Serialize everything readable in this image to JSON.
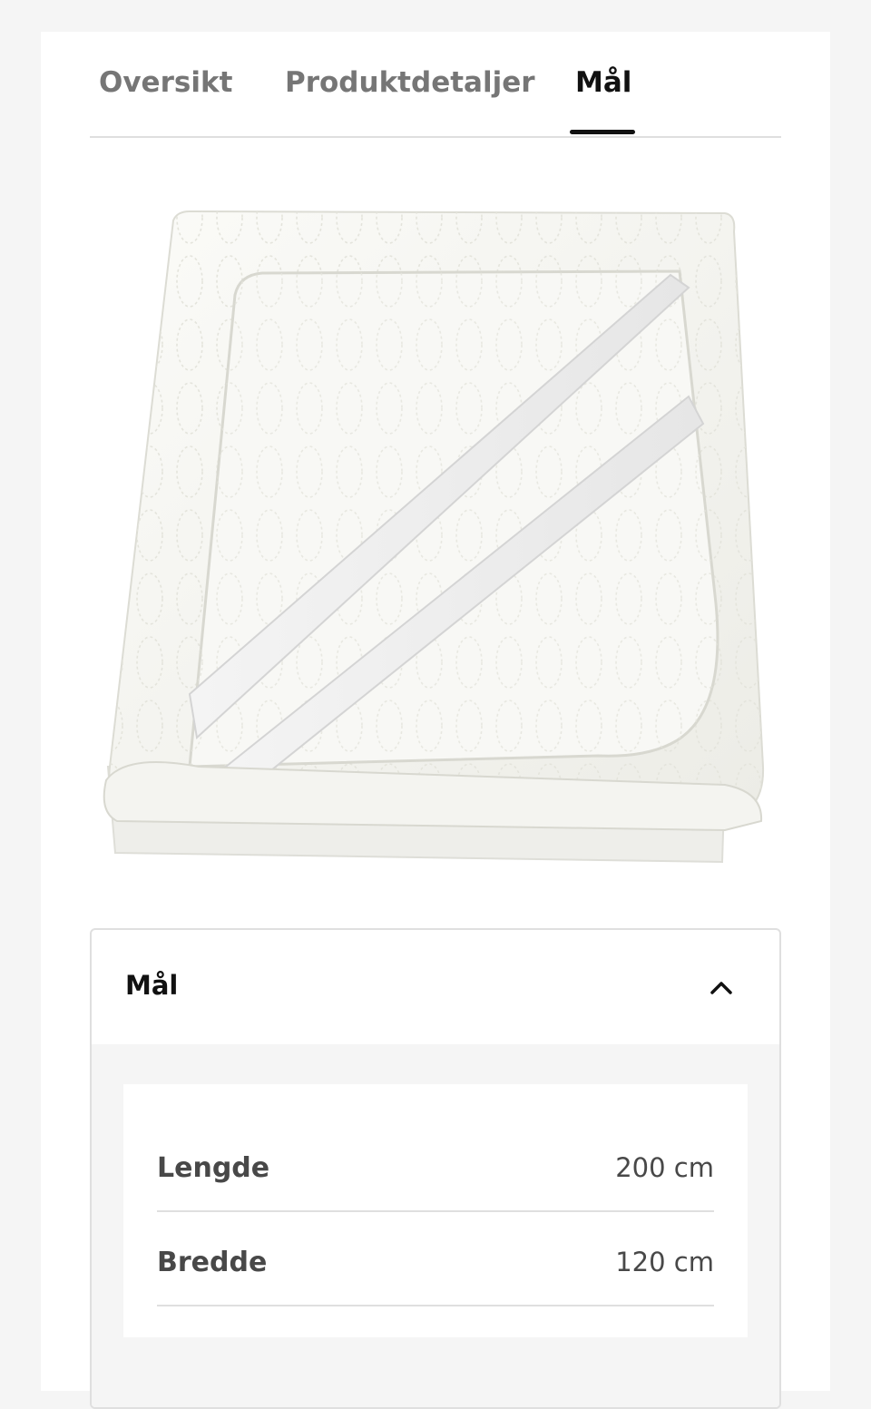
{
  "tabs": [
    {
      "label": "Oversikt",
      "active": false
    },
    {
      "label": "Produktdetaljer",
      "active": false
    },
    {
      "label": "Mål",
      "active": true
    }
  ],
  "accordion": {
    "title": "Mål",
    "expanded": true,
    "toggle_icon": "chevron-up-icon",
    "rows": [
      {
        "label": "Lengde",
        "value": "200 cm"
      },
      {
        "label": "Bredde",
        "value": "120 cm"
      }
    ]
  },
  "colors": {
    "active_tab": "#111111",
    "inactive_tab": "#767676",
    "divider": "#dfdfdf",
    "page_background": "#f5f5f5"
  }
}
